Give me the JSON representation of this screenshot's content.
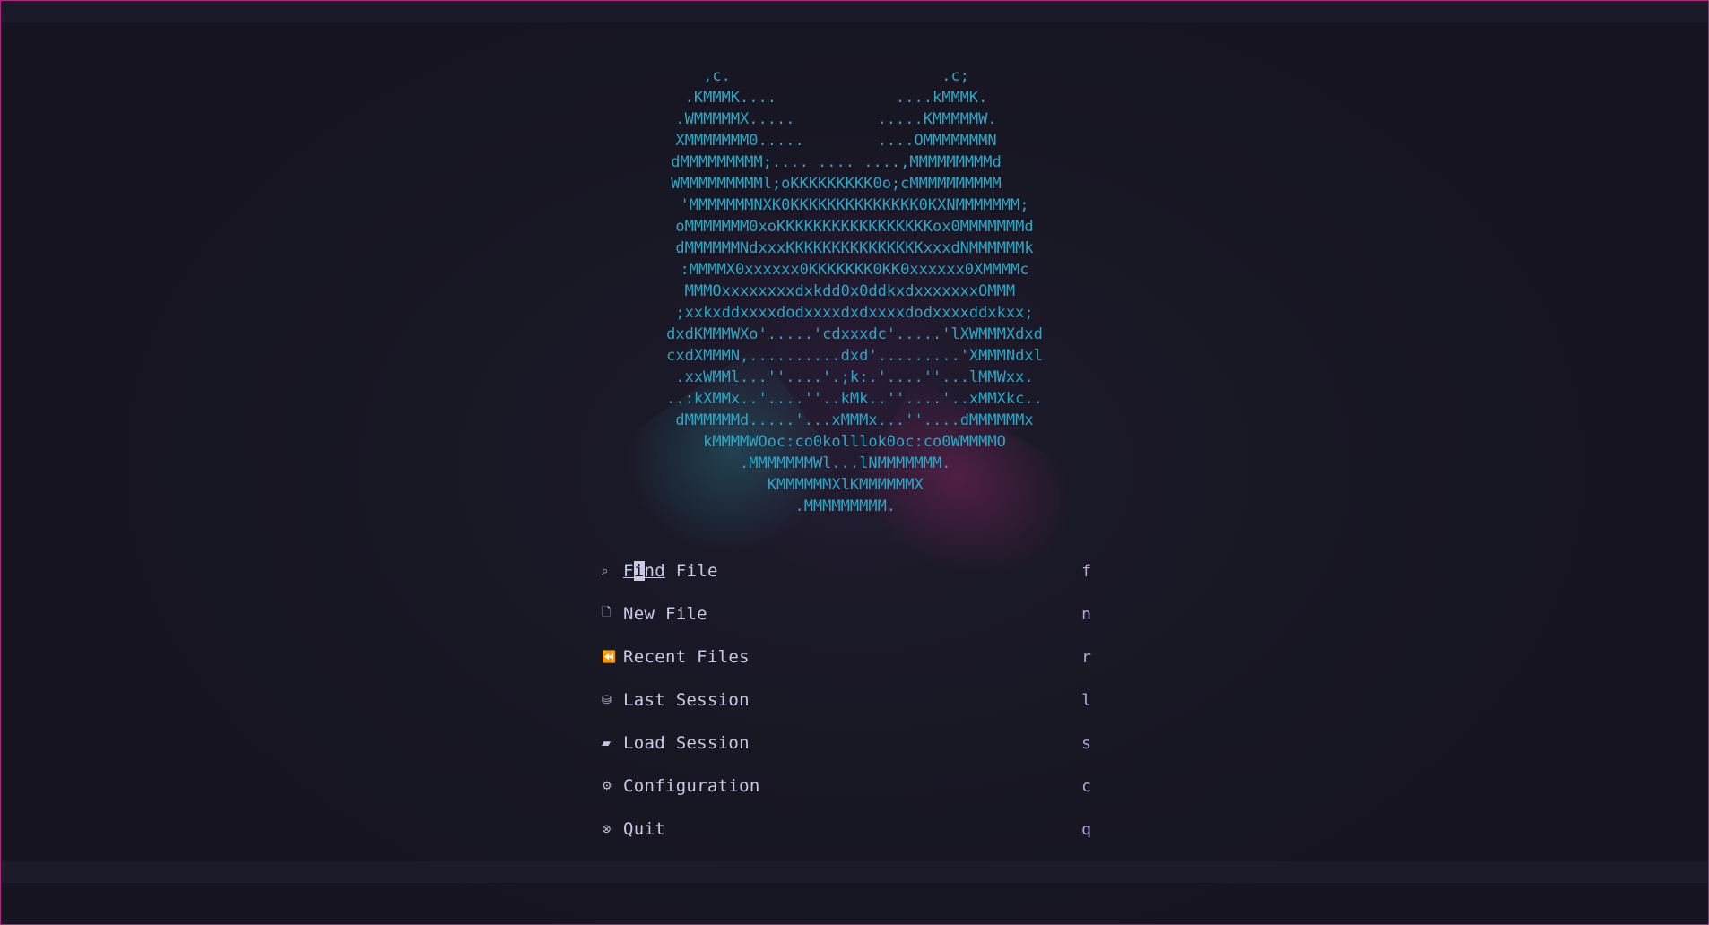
{
  "ascii_art": {
    "lines": [
      "   ,c.                       .c;       ",
      " .KMMMK....             ....kMMMK.     ",
      ".WMMMMMX.....         .....KMMMMMW.    ",
      "XMMMMMMM0.....        ....OMMMMMMMN    ",
      "dMMMMMMMMM;.... .... ....,MMMMMMMMMd    ",
      "WMMMMMMMMMl;oKKKKKKKKK0o;cMMMMMMMMMM    ",
      "'MMMMMMMNXK0KKKKKKKKKKKKKK0KXNMMMMMMM;",
      "oMMMMMMM0xoKKKKKKKKKKKKKKKKKox0MMMMMMMd",
      "dMMMMMMNdxxxKKKKKKKKKKKKKKKxxxdNMMMMMMk",
      ":MMMMX0xxxxxx0KKKKKKK0KK0xxxxxx0XMMMMc",
      " MMMOxxxxxxxxdxkdd0x0ddkxdxxxxxxxOMMM  ",
      ";xxkxddxxxxdodxxxxdxdxxxxdodxxxxddxkxx;",
      "dxdKMMMWXo'.....'cdxxxdc'.....'lXWMMMXdxd",
      "cxdXMMMN,..........dxd'.........'XMMMNdxl",
      " .xxWMMl...''....'.;k:.'....''...lMMWxx. ",
      "..:kXMMx..'....''..kMk..''....'..xMMXkc..",
      " dMMMMMMd.....'...xMMMx...''....dMMMMMMx ",
      "    kMMMMWOoc:co0kolllok0oc:co0WMMMMO    ",
      "        .MMMMMMMWl...lNMMMMMMM.          ",
      "           KMMMMMMXlKMMMMMMX             ",
      "              .MMMMMMMMM.                "
    ]
  },
  "menu": {
    "items": [
      {
        "label": "Find File",
        "key": "f",
        "icon": "file-search-icon",
        "glyph": "⌕"
      },
      {
        "label": "New File",
        "key": "n",
        "icon": "new-file-icon",
        "glyph": "🗋"
      },
      {
        "label": "Recent Files",
        "key": "r",
        "icon": "history-icon",
        "glyph": "⏪"
      },
      {
        "label": "Last Session",
        "key": "l",
        "icon": "session-icon",
        "glyph": "⛁"
      },
      {
        "label": "Load Session",
        "key": "s",
        "icon": "folder-icon",
        "glyph": "▰"
      },
      {
        "label": "Configuration",
        "key": "c",
        "icon": "gear-icon",
        "glyph": "⚙"
      },
      {
        "label": "Quit",
        "key": "q",
        "icon": "quit-icon",
        "glyph": "⊗"
      }
    ]
  },
  "colors": {
    "art": "#2aa8c8",
    "menu_text": "#c8c9e4",
    "key_text": "#b7a5dc",
    "border": "#b0267f"
  }
}
